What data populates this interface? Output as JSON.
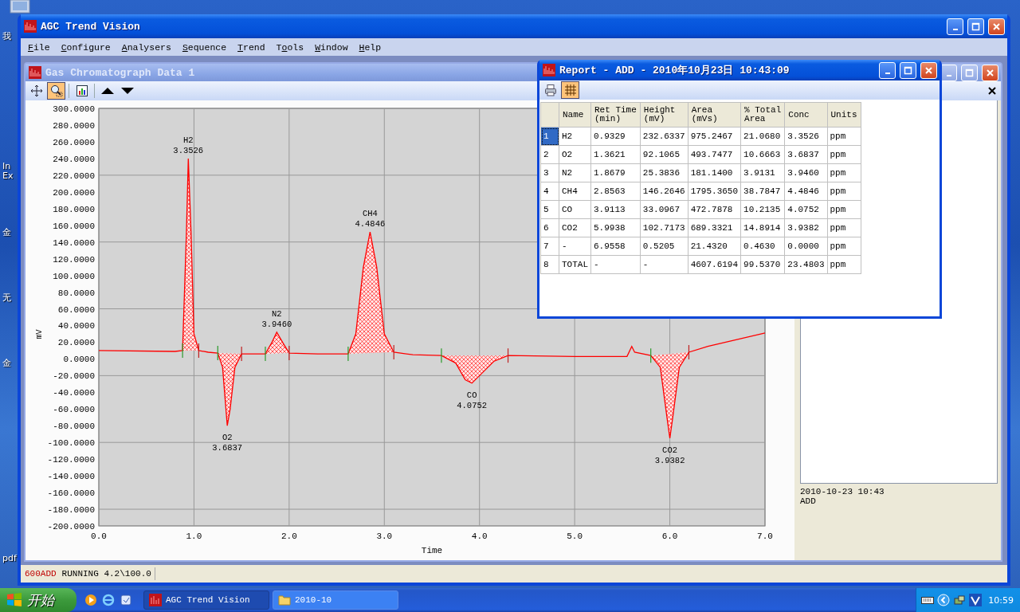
{
  "desktop": {
    "icons": [
      {
        "label": "我"
      },
      {
        "label": "In"
      },
      {
        "label": "Ex"
      },
      {
        "label": "金"
      },
      {
        "label": "无"
      },
      {
        "label": "金"
      },
      {
        "label": "pdf"
      }
    ]
  },
  "window": {
    "title": "AGC Trend Vision"
  },
  "menu": [
    {
      "key": "F",
      "after": "ile"
    },
    {
      "key": "C",
      "after": "onfigure"
    },
    {
      "key": "A",
      "after": "nalysers"
    },
    {
      "key": "S",
      "after": "equence"
    },
    {
      "key": "T",
      "after": "rend"
    },
    {
      "before": "T",
      "key": "o",
      "after": "ols"
    },
    {
      "key": "W",
      "after": "indow"
    },
    {
      "key": "H",
      "after": "elp"
    }
  ],
  "chart_window": {
    "title": "Gas Chromatograph Data 1",
    "tools": [
      {
        "kind": "pan",
        "active": false
      },
      {
        "kind": "zoom",
        "active": true
      },
      {
        "kind": "report",
        "active": false
      },
      {
        "kind": "up",
        "active": false
      },
      {
        "kind": "down",
        "active": false
      }
    ],
    "chart_data": {
      "type": "line",
      "xlabel": "Time",
      "ylabel": "mV",
      "xlim": [
        0,
        7
      ],
      "ylim": [
        -200,
        300
      ],
      "xticks": [
        {
          "value": 0,
          "label": "0.0"
        },
        {
          "value": 1,
          "label": "1.0"
        },
        {
          "value": 2,
          "label": "2.0"
        },
        {
          "value": 3,
          "label": "3.0"
        },
        {
          "value": 4,
          "label": "4.0"
        },
        {
          "value": 5,
          "label": "5.0"
        },
        {
          "value": 6,
          "label": "6.0"
        },
        {
          "value": 7,
          "label": "7.0"
        }
      ],
      "yticks": [
        {
          "value": 300,
          "label": "300.0000"
        },
        {
          "value": 280,
          "label": "280.0000"
        },
        {
          "value": 260,
          "label": "260.0000"
        },
        {
          "value": 240,
          "label": "240.0000"
        },
        {
          "value": 220,
          "label": "220.0000"
        },
        {
          "value": 200,
          "label": "200.0000"
        },
        {
          "value": 180,
          "label": "180.0000"
        },
        {
          "value": 160,
          "label": "160.0000"
        },
        {
          "value": 140,
          "label": "140.0000"
        },
        {
          "value": 120,
          "label": "120.0000"
        },
        {
          "value": 100,
          "label": "100.0000"
        },
        {
          "value": 80,
          "label": "80.0000"
        },
        {
          "value": 60,
          "label": "60.0000"
        },
        {
          "value": 40,
          "label": "40.0000"
        },
        {
          "value": 20,
          "label": "20.0000"
        },
        {
          "value": 0,
          "label": "0.0000"
        },
        {
          "value": -20,
          "label": "-20.0000"
        },
        {
          "value": -40,
          "label": "-40.0000"
        },
        {
          "value": -60,
          "label": "-60.0000"
        },
        {
          "value": -80,
          "label": "-80.0000"
        },
        {
          "value": -100,
          "label": "-100.0000"
        },
        {
          "value": -120,
          "label": "-120.0000"
        },
        {
          "value": -140,
          "label": "-140.0000"
        },
        {
          "value": -160,
          "label": "-160.0000"
        },
        {
          "value": -180,
          "label": "-180.0000"
        },
        {
          "value": -200,
          "label": "-200.0000"
        }
      ],
      "x": [
        0,
        0.8,
        0.88,
        0.92,
        0.94,
        0.97,
        1.0,
        1.05,
        1.15,
        1.25,
        1.3,
        1.35,
        1.38,
        1.43,
        1.5,
        1.75,
        1.82,
        1.87,
        1.93,
        2.0,
        2.3,
        2.62,
        2.7,
        2.78,
        2.85,
        2.92,
        3.0,
        3.1,
        3.3,
        3.6,
        3.75,
        3.85,
        3.92,
        4.0,
        4.15,
        4.3,
        5.0,
        5.55,
        5.6,
        5.63,
        5.8,
        5.9,
        5.97,
        6.0,
        6.03,
        6.1,
        6.2,
        6.4,
        7.0
      ],
      "grid": true,
      "series": [
        {
          "color": "#ff0000",
          "values": [
            10,
            9,
            10,
            150,
            240,
            150,
            30,
            10,
            8,
            7,
            -10,
            -80,
            -60,
            -10,
            6,
            6,
            20,
            32,
            20,
            7,
            6,
            6,
            30,
            110,
            152,
            110,
            30,
            8,
            5,
            4,
            -5,
            -25,
            -29,
            -20,
            -3,
            4,
            3,
            3,
            15,
            8,
            4,
            -10,
            -70,
            -95,
            -70,
            -10,
            8,
            15,
            31
          ]
        }
      ],
      "annotations": [
        {
          "text": "H2\n3.3526",
          "x": 0.94,
          "y": 240
        },
        {
          "text": "O2\n3.6837",
          "x": 1.35,
          "y": -80
        },
        {
          "text": "N2\n3.9460",
          "x": 1.87,
          "y": 32
        },
        {
          "text": "CH4\n4.4846",
          "x": 2.85,
          "y": 152
        },
        {
          "text": "CO\n4.0752",
          "x": 3.92,
          "y": -29
        },
        {
          "text": "CO2\n3.9382",
          "x": 6.0,
          "y": -95
        }
      ]
    },
    "side_panel": {
      "lines": [
        "2010-10-23 10:43",
        "ADD"
      ]
    }
  },
  "report": {
    "title": "Report - ADD - 2010年10月23日 10:43:09",
    "tools": [
      {
        "kind": "print",
        "active": false
      },
      {
        "kind": "grid",
        "active": true
      }
    ],
    "columns": [
      "Name",
      "Ret Time\n(min)",
      "Height\n(mV)",
      "Area\n(mVs)",
      "% Total\nArea",
      "Conc",
      "Units"
    ],
    "rows": [
      {
        "index": "1",
        "selected": true,
        "cells": [
          "H2",
          "0.9329",
          "232.6337",
          "975.2467",
          "21.0680",
          "3.3526",
          "ppm"
        ]
      },
      {
        "index": "2",
        "selected": false,
        "cells": [
          "O2",
          "1.3621",
          "92.1065",
          "493.7477",
          "10.6663",
          "3.6837",
          "ppm"
        ]
      },
      {
        "index": "3",
        "selected": false,
        "cells": [
          "N2",
          "1.8679",
          "25.3836",
          "181.1400",
          "3.9131",
          "3.9460",
          "ppm"
        ]
      },
      {
        "index": "4",
        "selected": false,
        "cells": [
          "CH4",
          "2.8563",
          "146.2646",
          "1795.3650",
          "38.7847",
          "4.4846",
          "ppm"
        ]
      },
      {
        "index": "5",
        "selected": false,
        "cells": [
          "CO",
          "3.9113",
          "33.0967",
          "472.7878",
          "10.2135",
          "4.0752",
          "ppm"
        ]
      },
      {
        "index": "6",
        "selected": false,
        "cells": [
          "CO2",
          "5.9938",
          "102.7173",
          "689.3321",
          "14.8914",
          "3.9382",
          "ppm"
        ]
      },
      {
        "index": "7",
        "selected": false,
        "cells": [
          "-",
          "6.9558",
          "0.5205",
          "21.4320",
          "0.4630",
          "0.0000",
          "ppm"
        ]
      },
      {
        "index": "8",
        "selected": false,
        "cells": [
          "TOTAL",
          "-",
          "-",
          "4607.6194",
          "99.5370",
          "23.4803",
          "ppm"
        ]
      }
    ]
  },
  "status_bar": {
    "code": "600ADD",
    "text": "RUNNING 4.2\\100.0"
  },
  "taskbar": {
    "start": "开始",
    "tasks": [
      {
        "kind": "app",
        "label": "AGC Trend Vision",
        "selected": true
      },
      {
        "kind": "folder",
        "label": "2010-10",
        "selected": false
      }
    ],
    "clock": "10:59"
  }
}
